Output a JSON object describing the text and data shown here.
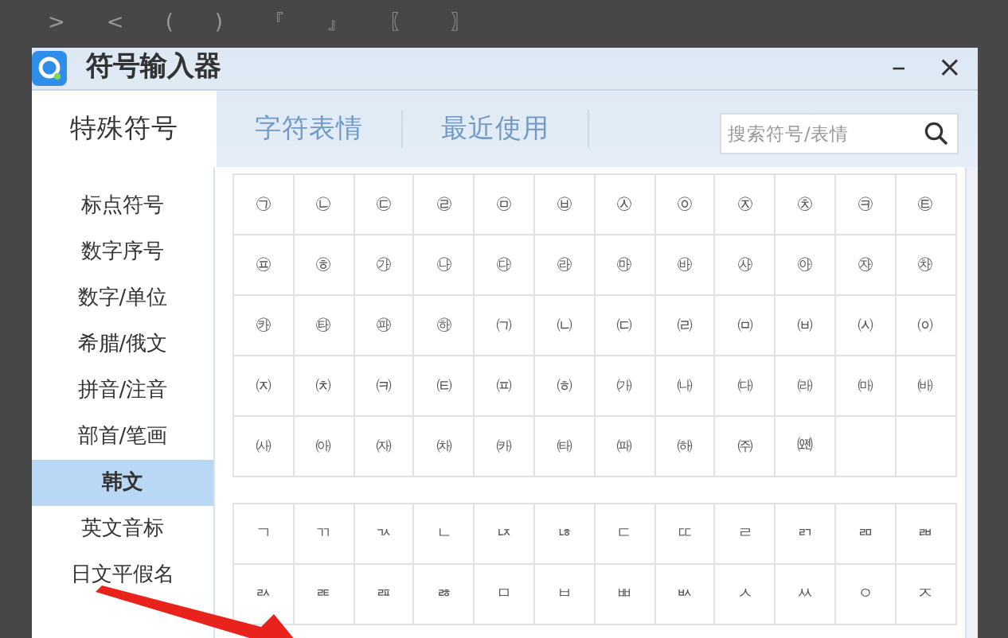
{
  "background_toolbar": [
    ">",
    "<",
    "(",
    ")",
    "『",
    "』",
    "〖",
    "〗"
  ],
  "window": {
    "title": "符号输入器",
    "buttons": [
      "–",
      "×"
    ]
  },
  "tabs": [
    {
      "label": "特殊符号",
      "selected": true
    },
    {
      "label": "字符表情",
      "selected": false
    },
    {
      "label": "最近使用",
      "selected": false
    }
  ],
  "search": {
    "placeholder": "搜索符号/表情"
  },
  "sidebar": {
    "items": [
      {
        "label": "标点符号",
        "selected": false
      },
      {
        "label": "数字序号",
        "selected": false
      },
      {
        "label": "数字/单位",
        "selected": false
      },
      {
        "label": "希腊/俄文",
        "selected": false
      },
      {
        "label": "拼音/注音",
        "selected": false
      },
      {
        "label": "部首/笔画",
        "selected": false
      },
      {
        "label": "韩文",
        "selected": true
      },
      {
        "label": "英文音标",
        "selected": false
      },
      {
        "label": "日文平假名",
        "selected": false
      }
    ]
  },
  "symbol_groups": [
    {
      "symbols": [
        "㉠",
        "㉡",
        "㉢",
        "㉣",
        "㉤",
        "㉥",
        "㉦",
        "㉧",
        "㉨",
        "㉩",
        "㉪",
        "㉫",
        "㉬",
        "㉭",
        "㉮",
        "㉯",
        "㉰",
        "㉱",
        "㉲",
        "㉳",
        "㉴",
        "㉵",
        "㉶",
        "㉷",
        "㉸",
        "㉹",
        "㉺",
        "㉻",
        "㈀",
        "㈁",
        "㈂",
        "㈃",
        "㈄",
        "㈅",
        "㈆",
        "㈇",
        "㈈",
        "㈉",
        "㈊",
        "㈋",
        "㈌",
        "㈍",
        "㈎",
        "㈏",
        "㈐",
        "㈑",
        "㈒",
        "㈓",
        "㈔",
        "㈕",
        "㈖",
        "㈗",
        "㈘",
        "㈙",
        "㈚",
        "㈛",
        "㈜",
        "㈝"
      ]
    },
    {
      "symbols": [
        "ㄱ",
        "ㄲ",
        "ㄳ",
        "ㄴ",
        "ㄵ",
        "ㄶ",
        "ㄷ",
        "ㄸ",
        "ㄹ",
        "ㄺ",
        "ㄻ",
        "ㄼ",
        "ㄽ",
        "ㄾ",
        "ㄿ",
        "ㅀ",
        "ㅁ",
        "ㅂ",
        "ㅃ",
        "ㅄ",
        "ㅅ",
        "ㅆ",
        "ㅇ",
        "ㅈ"
      ]
    }
  ]
}
